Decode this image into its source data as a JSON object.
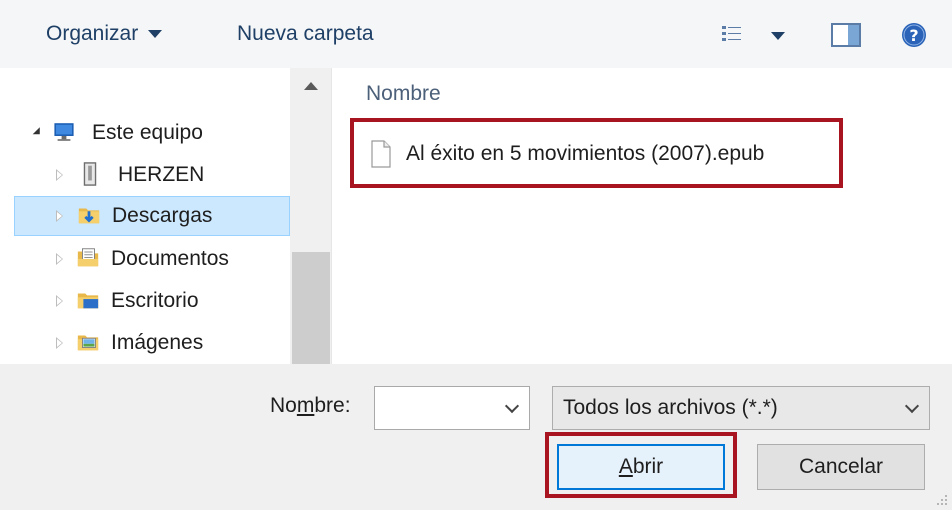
{
  "toolbar": {
    "organize_label": "Organizar",
    "new_folder_label": "Nueva carpeta"
  },
  "nav": {
    "items": [
      {
        "label": "Este equipo",
        "icon": "computer-icon"
      },
      {
        "label": "HERZEN",
        "icon": "drive-icon"
      },
      {
        "label": "Descargas",
        "icon": "downloads-folder-icon"
      },
      {
        "label": "Documentos",
        "icon": "documents-folder-icon"
      },
      {
        "label": "Escritorio",
        "icon": "desktop-folder-icon"
      },
      {
        "label": "Imágenes",
        "icon": "pictures-folder-icon"
      }
    ]
  },
  "content": {
    "column_name": "Nombre",
    "files": [
      {
        "name": "Al éxito en 5 movimientos (2007).epub",
        "icon": "document-icon"
      }
    ]
  },
  "footer": {
    "filename_label_pre": "No",
    "filename_label_u": "m",
    "filename_label_post": "bre:",
    "filename_value": "",
    "filetype_value": "Todos los archivos (*.*)",
    "open_u": "A",
    "open_rest": "brir",
    "cancel_label": "Cancelar"
  },
  "colors": {
    "highlight": "#a8141f",
    "selection_bg": "#cce8ff",
    "link_text": "#1e3f66"
  }
}
